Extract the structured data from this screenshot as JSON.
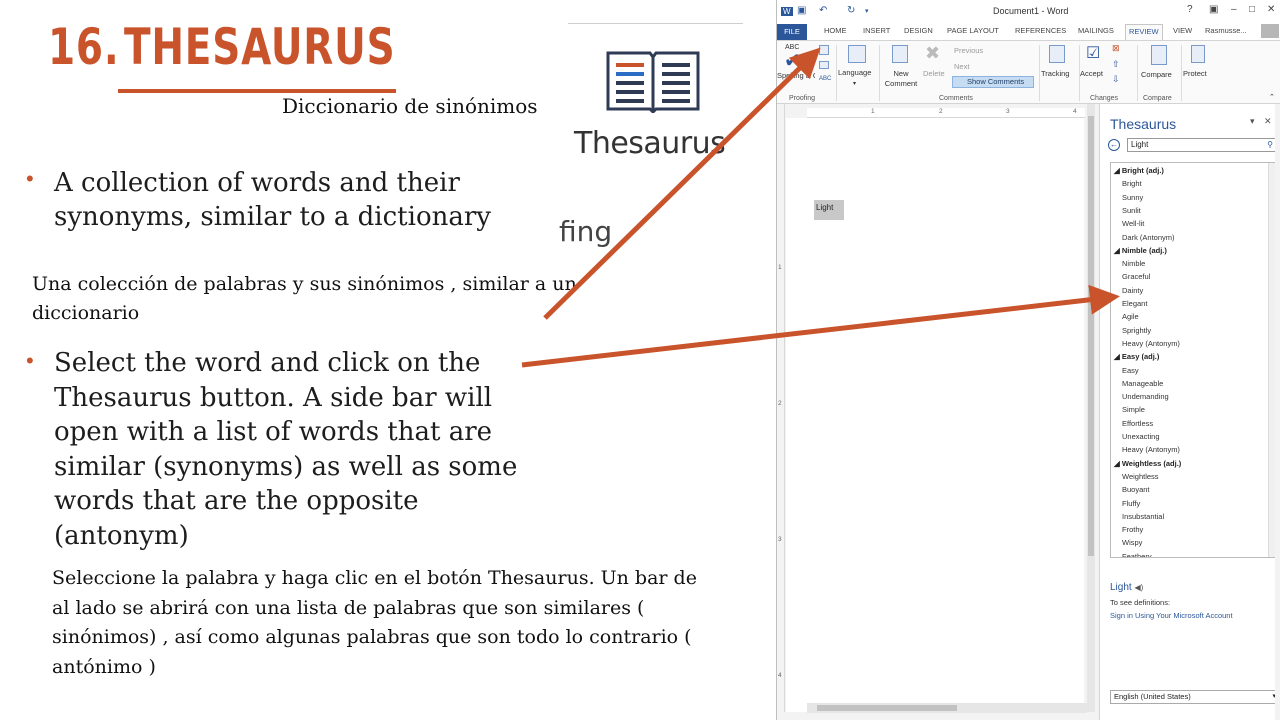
{
  "slide": {
    "title_number": "16.",
    "title_word": "THESAURUS",
    "subtitle": "Diccionario de sinónimos",
    "bullet1": "A collection of words and their synonyms, similar to a dictionary",
    "bullet1_spanish": "Una colección de palabras y sus sinónimos , similar a un diccionario",
    "bullet2": "Select the word and click on the Thesaurus button. A side bar will open with a list of words that are similar (synonyms) as well as some words that are the opposite (antonym)",
    "bullet2_spanish": "Seleccione la palabra y haga clic en el botón Thesaurus. Un bar de al lado se abrirá con una lista de palabras que son similares ( sinónimos) , así como algunas palabras que son todo lo contrario ( antónimo )",
    "enlarged_button_label": "Thesaurus",
    "enlarged_partial_label": "fing",
    "accent_color": "#c9532b"
  },
  "word": {
    "window_title": "Document1 - Word",
    "help": "?",
    "tabs": [
      "FILE",
      "HOME",
      "INSERT",
      "DESIGN",
      "PAGE LAYOUT",
      "REFERENCES",
      "MAILINGS",
      "REVIEW",
      "VIEW"
    ],
    "user": "Rasmusse...",
    "ribbon": {
      "spelling_label": "Spelling & Gramm",
      "abc_label": "ABC",
      "language_label": "Language",
      "new_comment_label": "New Comment",
      "delete_label": "Delete",
      "previous_label": "Previous",
      "next_label": "Next",
      "show_comments_label": "Show Comments",
      "tracking_label": "Tracking",
      "accept_label": "Accept",
      "compare_label": "Compare",
      "protect_label": "Protect",
      "groups": {
        "proofing": "Proofing",
        "comments": "Comments",
        "changes": "Changes",
        "compare": "Compare"
      }
    },
    "ruler_numbers": [
      "1",
      "2",
      "3",
      "4"
    ],
    "vruler_numbers": [
      "1",
      "2",
      "3",
      "4"
    ],
    "document_word": "Light",
    "thesaurus_pane": {
      "title": "Thesaurus",
      "search_value": "Light",
      "groups": [
        {
          "heading": "Bright (adj.)",
          "items": [
            "Bright",
            "Sunny",
            "Sunlit",
            "Well-lit",
            "Dark (Antonym)"
          ]
        },
        {
          "heading": "Nimble (adj.)",
          "items": [
            "Nimble",
            "Graceful",
            "Dainty",
            "Elegant",
            "Agile",
            "Sprightly",
            "Heavy (Antonym)"
          ]
        },
        {
          "heading": "Easy (adj.)",
          "items": [
            "Easy",
            "Manageable",
            "Undemanding",
            "Simple",
            "Effortless",
            "Unexacting",
            "Heavy (Antonym)"
          ]
        },
        {
          "heading": "Weightless (adj.)",
          "items": [
            "Weightless",
            "Buoyant",
            "Fluffy",
            "Insubstantial",
            "Frothy",
            "Wispy",
            "Feathery"
          ]
        }
      ],
      "definition_word": "Light",
      "definition_hint": "To see definitions:",
      "sign_in_link": "Sign in Using Your Microsoft Account",
      "language": "English (United States)"
    }
  }
}
